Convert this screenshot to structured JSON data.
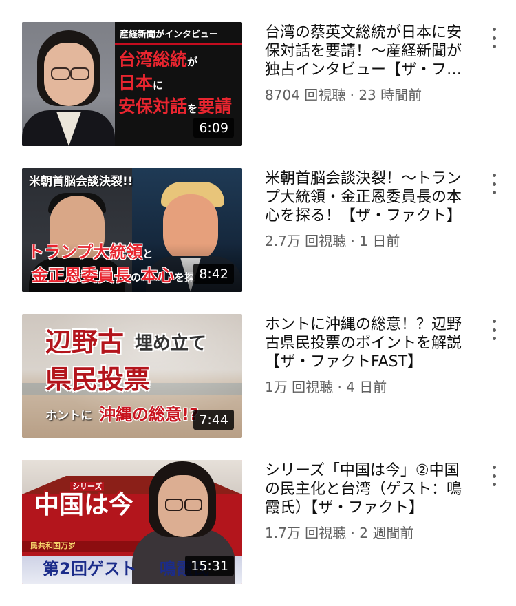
{
  "videos": [
    {
      "title": "台湾の蔡英文総統が日本に安保対話を要請！〜産経新聞が独占インタビュー【ザ・ファクト】",
      "meta": "8704 回視聴 · 23 時間前",
      "duration": "6:09",
      "thumb_text": [
        "産経新聞がインタビュー",
        "台湾総統",
        "が",
        "日本",
        "に",
        "安保対話",
        "を",
        "要請"
      ]
    },
    {
      "title": "米朝首脳会談決裂！〜トランプ大統領・金正恩委員長の本心を探る！【ザ・ファクト】",
      "meta": "2.7万 回視聴 · 1 日前",
      "duration": "8:42",
      "thumb_text": [
        "米朝首脳会談決裂!!",
        "トランプ大統領",
        "と",
        "金正恩委員長",
        "の",
        "本心",
        "を探"
      ]
    },
    {
      "title": "ホントに沖縄の総意！？辺野古県民投票のポイントを解説【ザ・ファクトFAST】",
      "meta": "1万 回視聴 · 4 日前",
      "duration": "7:44",
      "thumb_text": [
        "辺野古",
        "埋め立て",
        "県民投票",
        "ホントに",
        "沖縄の総意!?"
      ]
    },
    {
      "title": "シリーズ「中国は今」②中国の民主化と台湾（ゲスト：鳴霞氏）【ザ・ファクト】",
      "meta": "1.7万 回視聴 · 2 週間前",
      "duration": "15:31",
      "thumb_text": [
        "シリーズ",
        "中国は今",
        "民共和国万岁",
        "第2回ゲスト",
        "鳴霞氏"
      ]
    }
  ]
}
